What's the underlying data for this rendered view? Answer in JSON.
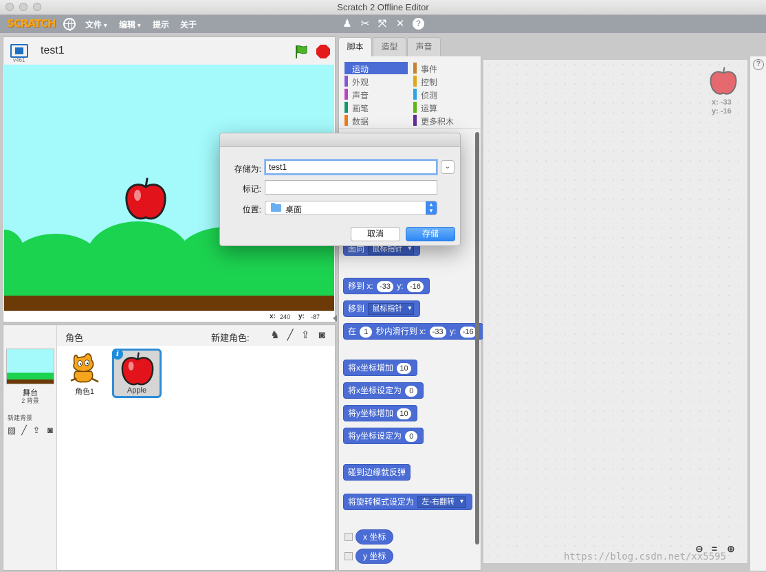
{
  "window": {
    "title": "Scratch 2 Offline Editor"
  },
  "menubar": {
    "logo": "SCRATCH",
    "items": [
      "文件",
      "编辑",
      "提示",
      "关于"
    ]
  },
  "stage": {
    "version": "v461",
    "project_title": "test1",
    "mouse_x_label": "x:",
    "mouse_x": "240",
    "mouse_y_label": "y:",
    "mouse_y": "-87"
  },
  "sprites": {
    "header_label": "角色",
    "new_sprite_label": "新建角色:",
    "stage_label": "舞台",
    "stage_sub": "2 背景",
    "new_backdrop_label": "新建背景",
    "items": [
      {
        "name": "角色1"
      },
      {
        "name": "Apple"
      }
    ]
  },
  "tabs": [
    "脚本",
    "造型",
    "声音"
  ],
  "categories": [
    {
      "label": "运动",
      "color": "#4a6cd4"
    },
    {
      "label": "外观",
      "color": "#8a55d7"
    },
    {
      "label": "声音",
      "color": "#bb42c3"
    },
    {
      "label": "画笔",
      "color": "#0e9a6c"
    },
    {
      "label": "数据",
      "color": "#ee7d16"
    },
    {
      "label": "事件",
      "color": "#c88330"
    },
    {
      "label": "控制",
      "color": "#e1a91a"
    },
    {
      "label": "侦测",
      "color": "#2ca5e2"
    },
    {
      "label": "运算",
      "color": "#5cb712"
    },
    {
      "label": "更多积木",
      "color": "#632d99"
    }
  ],
  "blocks": {
    "face_toward": {
      "text": "面向",
      "target": "鼠标指针"
    },
    "goto_xy": {
      "text": "移到",
      "x_label": "x:",
      "x": "-33",
      "y_label": "y:",
      "y": "-16"
    },
    "goto_target": {
      "text": "移到",
      "target": "鼠标指针"
    },
    "glide": {
      "prefix": "在",
      "secs": "1",
      "mid": "秒内滑行到",
      "x_label": "x:",
      "x": "-33",
      "y_label": "y:",
      "y": "-16"
    },
    "change_x": {
      "text": "将x坐标增加",
      "value": "10"
    },
    "set_x": {
      "text": "将x坐标设定为",
      "value": "0"
    },
    "change_y": {
      "text": "将y坐标增加",
      "value": "10"
    },
    "set_y": {
      "text": "将y坐标设定为",
      "value": "0"
    },
    "bounce": {
      "text": "碰到边缘就反弹"
    },
    "rotation_style": {
      "text": "将旋转模式设定为",
      "value": "左-右翻转"
    },
    "x_position": "x 坐标",
    "y_position": "y 坐标"
  },
  "script_area": {
    "sprite_x": "x: -33",
    "sprite_y": "y: -16"
  },
  "dialog": {
    "save_as_label": "存储为:",
    "save_as_value": "test1",
    "tags_label": "标记:",
    "tags_value": "",
    "where_label": "位置:",
    "where_value": "桌面",
    "cancel_label": "取消",
    "save_label": "存储"
  },
  "watermark": "https://blog.csdn.net/xx5595",
  "icons": {
    "globe": "globe-icon",
    "duplicate": "stamp-icon",
    "cut": "scissors-icon",
    "grow": "grow-icon",
    "shrink": "shrink-icon",
    "help": "help-icon"
  }
}
